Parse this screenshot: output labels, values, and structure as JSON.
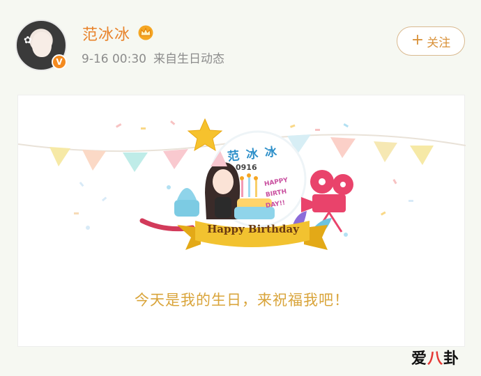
{
  "header": {
    "user_name": "范冰冰",
    "timestamp": "9-16 00:30",
    "source": "来自生日动态",
    "follow_label": "关注",
    "follow_icon": "plus-icon",
    "crown_icon": "crown-icon",
    "verified_icon": "verified-v-icon",
    "verified_letter": "V"
  },
  "card": {
    "ring_name": "范 冰 冰",
    "date_code": "0916",
    "banner_text": "Happy Birthday",
    "side_text_1": "HAPPY",
    "side_text_2": "BIRTH",
    "side_text_3": "DAY!!",
    "message": "今天是我的生日，来祝福我吧！"
  },
  "watermark": {
    "part1": "爱",
    "part2": "八",
    "part3": "卦"
  },
  "colors": {
    "name": "#e8822a",
    "follow_border": "#d9b98f",
    "message": "#d9a43a",
    "banner": "#f2c230"
  }
}
